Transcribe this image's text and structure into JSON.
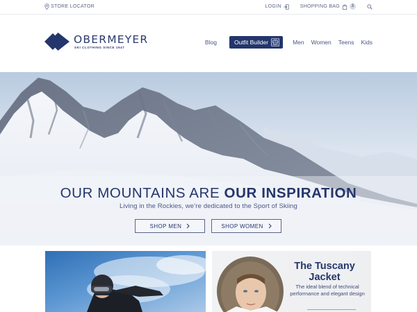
{
  "topbar": {
    "store_locator": "STORE LOCATOR",
    "login": "LOGIN",
    "shopping_bag": "SHOPPING BAG",
    "bag_count": "3"
  },
  "brand": {
    "name": "OBERMEYER",
    "tagline": "SKI CLOTHING SINCE 1947",
    "color": "#24366c"
  },
  "nav": {
    "blog": "Blog",
    "outfit_builder": "Outfit Builder",
    "men": "Men",
    "women": "Women",
    "teens": "Teens",
    "kids": "Kids"
  },
  "hero": {
    "title_light": "OUR MOUNTAINS ARE ",
    "title_bold": "OUR INSPIRATION",
    "subtitle": "Living in the Rockies, we’re dedicated to the Sport of Skiing",
    "shop_men": "SHOP MEN",
    "shop_women": "SHOP WOMEN"
  },
  "cards": {
    "jacket_title": "The Tuscany Jacket",
    "jacket_desc": "The ideal blend of technical performance and elegant design"
  },
  "icons": [
    "map-pin-icon",
    "login-icon",
    "shopping-bag-icon",
    "search-icon",
    "outfit-builder-icon",
    "chevron-right-icon"
  ]
}
